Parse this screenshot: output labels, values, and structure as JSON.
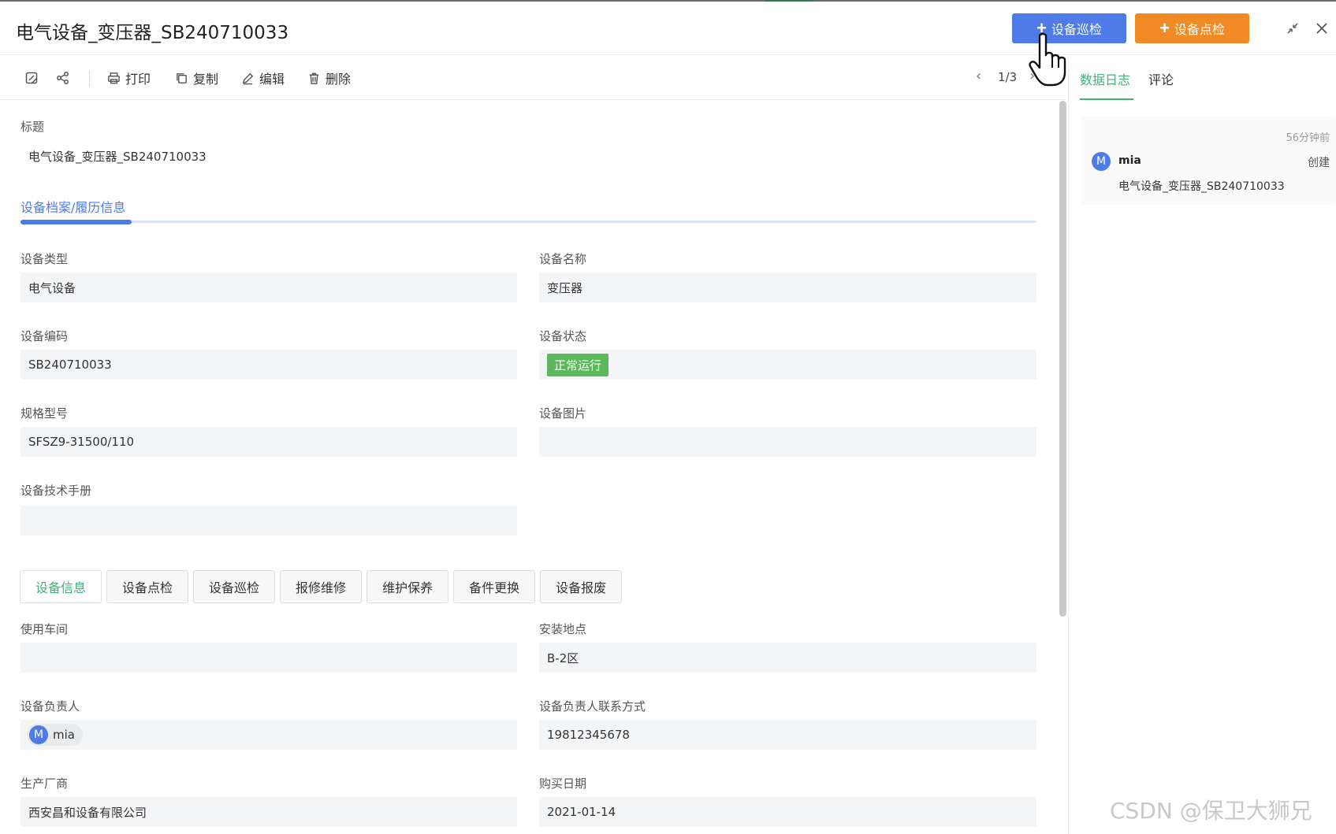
{
  "header": {
    "title": "电气设备_变压器_SB240710033",
    "btn_patrol": "设备巡检",
    "btn_spot": "设备点检",
    "plus": "+"
  },
  "toolbar": {
    "print": "打印",
    "copy": "复制",
    "edit": "编辑",
    "delete": "删除",
    "pager": "1/3"
  },
  "record": {
    "title_label": "标题",
    "title_value": "电气设备_变压器_SB240710033",
    "section_tab": "设备档案/履历信息"
  },
  "fields": {
    "type_label": "设备类型",
    "type_value": "电气设备",
    "name_label": "设备名称",
    "name_value": "变压器",
    "code_label": "设备编码",
    "code_value": "SB240710033",
    "status_label": "设备状态",
    "status_value": "正常运行",
    "model_label": "规格型号",
    "model_value": "SFSZ9-31500/110",
    "image_label": "设备图片",
    "manual_label": "设备技术手册"
  },
  "tabs": [
    "设备信息",
    "设备点检",
    "设备巡检",
    "报修维修",
    "维护保养",
    "备件更换",
    "设备报废"
  ],
  "info": {
    "workshop_label": "使用车间",
    "location_label": "安装地点",
    "location_value": "B-2区",
    "owner_label": "设备负责人",
    "owner_initial": "M",
    "owner_name": "mia",
    "contact_label": "设备负责人联系方式",
    "contact_value": "19812345678",
    "maker_label": "生产厂商",
    "maker_value": "西安昌和设备有限公司",
    "purchase_label": "购买日期",
    "purchase_value": "2021-01-14"
  },
  "right_panel": {
    "tab_log": "数据日志",
    "tab_comment": "评论",
    "log": {
      "time": "56分钟前",
      "initial": "M",
      "user": "mia",
      "action": "创建",
      "detail": "电气设备_变压器_SB240710033"
    }
  },
  "watermark": "CSDN @保卫大狮兄",
  "colors": {
    "primary_blue": "#4e7be8",
    "orange": "#f08a24",
    "green_active": "#45b07a",
    "status_green": "#5bb95b"
  }
}
